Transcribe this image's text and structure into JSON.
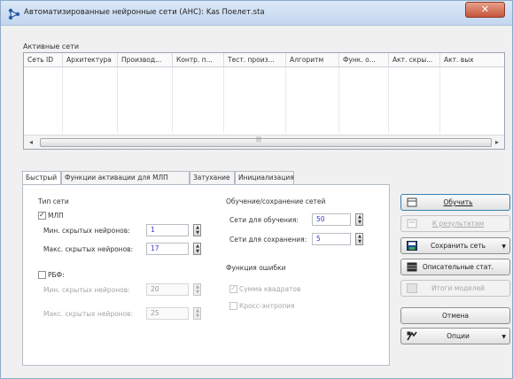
{
  "window": {
    "title": "Автоматизированные нейронные сети (АНС): Kas Поелет.sta",
    "close_label": "✕",
    "app_icon": "network-app-icon"
  },
  "grid": {
    "label": "Активные сети",
    "columns": [
      "Сеть ID",
      "Архитектура",
      "Производ...",
      "Контр. п...",
      "Тест. произ...",
      "Алгоритм",
      "Функ. о...",
      "Акт. скры...",
      "Акт. вых"
    ]
  },
  "tabs": [
    {
      "label": "Быстрый",
      "active": true
    },
    {
      "label": "Функции активации для МЛП",
      "active": false
    },
    {
      "label": "Затухание",
      "active": false
    },
    {
      "label": "Инициализация",
      "active": false
    }
  ],
  "net_type": {
    "title": "Тип сети",
    "mlp_label": "МЛП",
    "mlp_checked": true,
    "mlp_min_label": "Мин. скрытых нейронов:",
    "mlp_min_value": "1",
    "mlp_max_label": "Макс. скрытых нейронов:",
    "mlp_max_value": "17",
    "rbf_label": "РБФ:",
    "rbf_checked": false,
    "rbf_min_label": "Мин. скрытых нейронов:",
    "rbf_min_value": "20",
    "rbf_max_label": "Макс. скрытых нейронов:",
    "rbf_max_value": "25"
  },
  "training": {
    "title": "Обучение/сохранение сетей",
    "train_label": "Сети для обучения:",
    "train_value": "50",
    "save_label": "Сети для сохранения:",
    "save_value": "5"
  },
  "error_fn": {
    "title": "Функция ошибки",
    "sum_squares_label": "Сумма квадратов",
    "sum_squares_checked": true,
    "cross_entropy_label": "Кросс-энтропия",
    "cross_entropy_checked": false
  },
  "buttons": {
    "train": "Обучить",
    "results": "К результатам",
    "save_networks": "Сохранить сеть",
    "descriptive": "Описательные стат.",
    "summary": "Итоги моделей",
    "cancel": "Отмена",
    "options": "Опции"
  },
  "colors": {
    "accent_value": "#3636d0",
    "titlebar": "#c3d7ef",
    "close": "#c7543a"
  }
}
